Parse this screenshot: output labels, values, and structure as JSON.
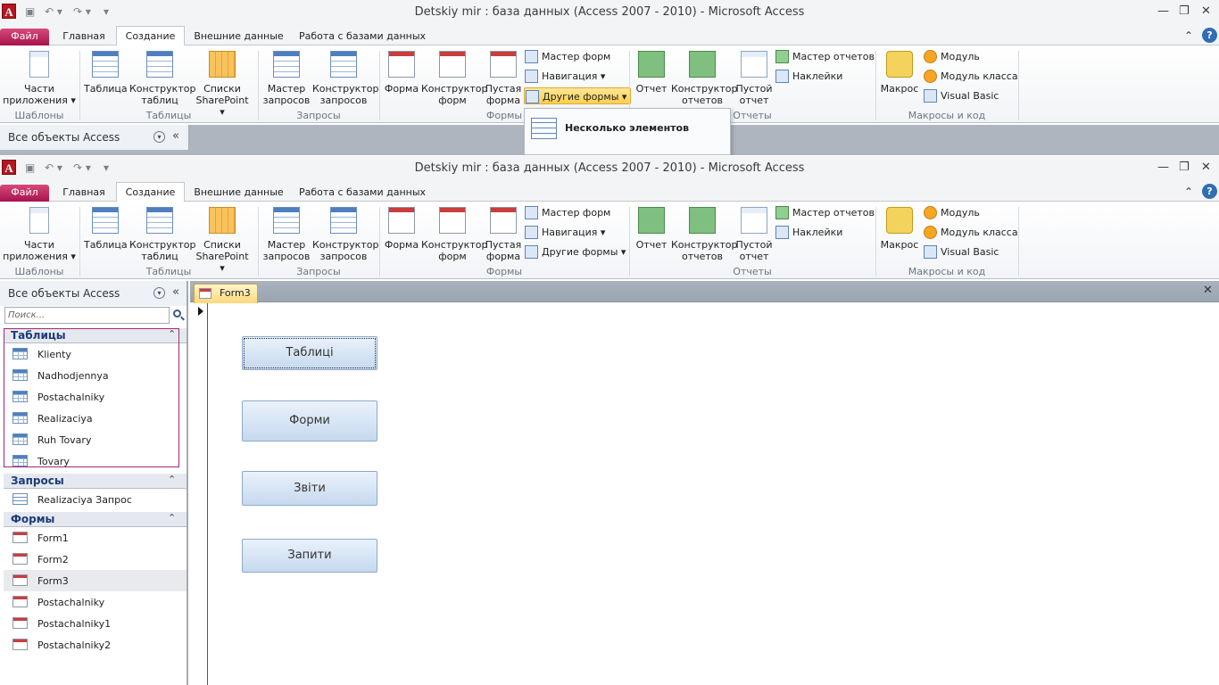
{
  "app": {
    "icon_letter": "A",
    "title": "Detskiy mir : база данных (Access 2007 - 2010)  -  Microsoft Access",
    "qat_icons": [
      "save-icon",
      "undo-icon",
      "redo-icon",
      "customize-qat-icon"
    ],
    "window_controls": {
      "minimize": "—",
      "restore": "❐",
      "close": "✕"
    }
  },
  "tabs": [
    {
      "label": "Файл"
    },
    {
      "label": "Главная"
    },
    {
      "label": "Создание"
    },
    {
      "label": "Внешние данные"
    },
    {
      "label": "Работа с базами данных"
    }
  ],
  "ribbon": {
    "groups": {
      "templates": "Шаблоны",
      "tables": "Таблицы",
      "queries": "Запросы",
      "forms": "Формы",
      "reports": "Отчеты",
      "macros": "Макросы и код"
    },
    "buttons": {
      "app_parts_1": "Части",
      "app_parts_2": "приложения ▾",
      "table": "Таблица",
      "table_design_1": "Конструктор",
      "table_design_2": "таблиц",
      "sharepoint_1": "Списки",
      "sharepoint_2": "SharePoint ▾",
      "query_wizard_1": "Мастер",
      "query_wizard_2": "запросов",
      "query_design_1": "Конструктор",
      "query_design_2": "запросов",
      "form": "Форма",
      "form_design_1": "Конструктор",
      "form_design_2": "форм",
      "blank_form_1": "Пустая",
      "blank_form_2": "форма",
      "form_wizard": "Мастер форм",
      "navigation": "Навигация ▾",
      "more_forms": "Другие формы ▾",
      "report": "Отчет",
      "report_design_1": "Конструктор",
      "report_design_2": "отчетов",
      "blank_report_1": "Пустой",
      "blank_report_2": "отчет",
      "report_wizard": "Мастер отчетов",
      "labels": "Наклейки",
      "macro": "Макрос",
      "module": "Модуль",
      "class_module": "Модуль класса",
      "visual_basic": "Visual Basic"
    }
  },
  "more_forms_menu": {
    "items": [
      {
        "label": "Несколько элементов"
      }
    ]
  },
  "nav_pane": {
    "title": "Все объекты Access",
    "search_placeholder": "Поиск...",
    "groups": [
      {
        "title": "Таблицы",
        "items": [
          "Klienty",
          "Nadhodjennya",
          "Postachalniky",
          "Realizaciya",
          "Ruh Tovary",
          "Tovary"
        ]
      },
      {
        "title": "Запросы",
        "items": [
          "Realizaciya Запрос"
        ]
      },
      {
        "title": "Формы",
        "items": [
          "Form1",
          "Form2",
          "Form3",
          "Postachalniky",
          "Postachalniky1",
          "Postachalniky2"
        ]
      }
    ]
  },
  "document": {
    "tab": "Form3",
    "buttons": [
      "Таблиці",
      "Форми",
      "Звіти",
      "Запити"
    ]
  },
  "colors": {
    "file_tab": "#b5164f",
    "active_doc_tab": "#ffd97a",
    "form_button": "#c6d9ee"
  }
}
